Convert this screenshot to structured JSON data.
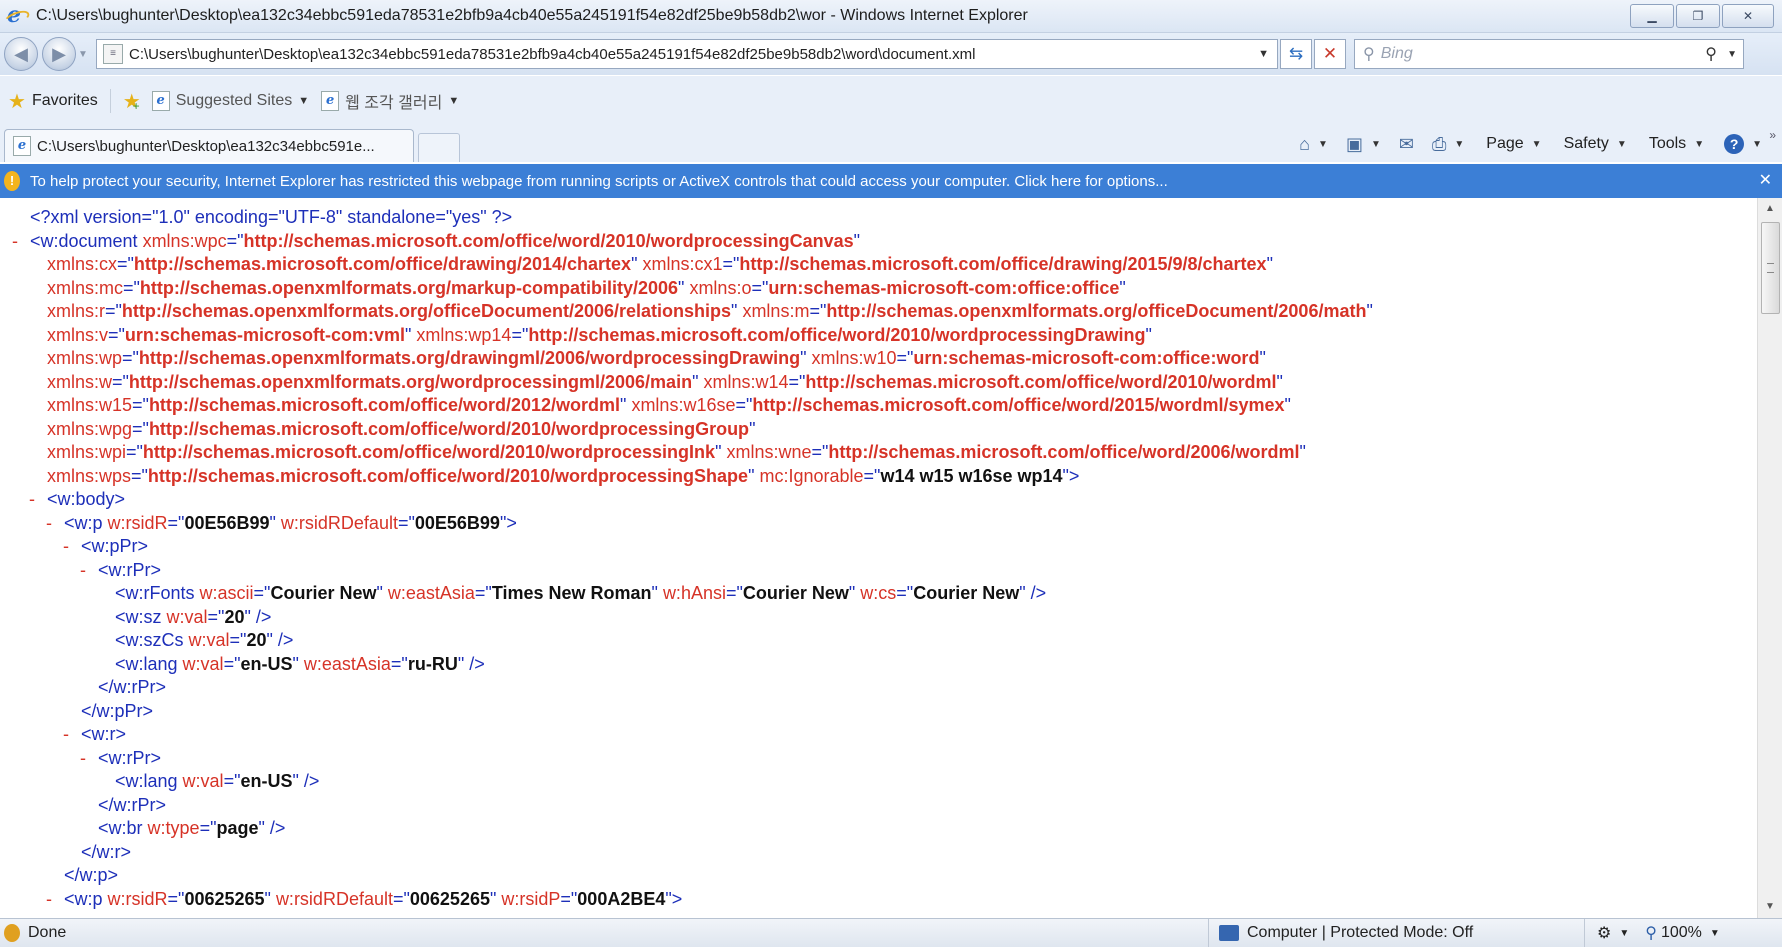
{
  "window": {
    "title": "C:\\Users\\bughunter\\Desktop\\ea132c34ebbc591eda78531e2bfb9a4cb40e55a245191f54e82df25be9b58db2\\wor - Windows Internet Explorer"
  },
  "address_bar": {
    "url": "C:\\Users\\bughunter\\Desktop\\ea132c34ebbc591eda78531e2bfb9a4cb40e55a245191f54e82df25be9b58db2\\word\\document.xml"
  },
  "search": {
    "placeholder": "Bing"
  },
  "favorites_bar": {
    "favorites_label": "Favorites",
    "links": [
      "Suggested Sites",
      "웹 조각 갤러리"
    ]
  },
  "tab": {
    "title": "C:\\Users\\bughunter\\Desktop\\ea132c34ebbc591e..."
  },
  "command_bar": {
    "page": "Page",
    "safety": "Safety",
    "tools": "Tools"
  },
  "info_bar": {
    "message": "To help protect your security, Internet Explorer has restricted this webpage from running scripts or ActiveX controls that could access your computer. Click here for options..."
  },
  "xml_lines": [
    {
      "indent": 0,
      "toggle": "",
      "parts": [
        [
          "tg",
          "<?xml "
        ],
        [
          "tg",
          "version=\""
        ],
        [
          "tg",
          "1.0"
        ],
        [
          "tg",
          "\" encoding=\""
        ],
        [
          "tg",
          "UTF-8"
        ],
        [
          "tg",
          "\" standalone=\""
        ],
        [
          "tg",
          "yes"
        ],
        [
          "tg",
          "\" ?>"
        ]
      ]
    },
    {
      "indent": 0,
      "toggle": "-",
      "parts": [
        [
          "tg",
          "<w:document "
        ],
        [
          "an",
          "xmlns:wpc"
        ],
        [
          "tg",
          "=\""
        ],
        [
          "uv",
          "http://schemas.microsoft.com/office/word/2010/wordprocessingCanvas"
        ],
        [
          "tg",
          "\""
        ]
      ]
    },
    {
      "indent": 1,
      "toggle": "",
      "parts": [
        [
          "an",
          "xmlns:cx"
        ],
        [
          "tg",
          "=\""
        ],
        [
          "uv",
          "http://schemas.microsoft.com/office/drawing/2014/chartex"
        ],
        [
          "tg",
          "\" "
        ],
        [
          "an",
          "xmlns:cx1"
        ],
        [
          "tg",
          "=\""
        ],
        [
          "uv",
          "http://schemas.microsoft.com/office/drawing/2015/9/8/chartex"
        ],
        [
          "tg",
          "\""
        ]
      ]
    },
    {
      "indent": 1,
      "toggle": "",
      "parts": [
        [
          "an",
          "xmlns:mc"
        ],
        [
          "tg",
          "=\""
        ],
        [
          "uv",
          "http://schemas.openxmlformats.org/markup-compatibility/2006"
        ],
        [
          "tg",
          "\" "
        ],
        [
          "an",
          "xmlns:o"
        ],
        [
          "tg",
          "=\""
        ],
        [
          "uv",
          "urn:schemas-microsoft-com:office:office"
        ],
        [
          "tg",
          "\""
        ]
      ]
    },
    {
      "indent": 1,
      "toggle": "",
      "parts": [
        [
          "an",
          "xmlns:r"
        ],
        [
          "tg",
          "=\""
        ],
        [
          "uv",
          "http://schemas.openxmlformats.org/officeDocument/2006/relationships"
        ],
        [
          "tg",
          "\" "
        ],
        [
          "an",
          "xmlns:m"
        ],
        [
          "tg",
          "=\""
        ],
        [
          "uv",
          "http://schemas.openxmlformats.org/officeDocument/2006/math"
        ],
        [
          "tg",
          "\""
        ]
      ]
    },
    {
      "indent": 1,
      "toggle": "",
      "parts": [
        [
          "an",
          "xmlns:v"
        ],
        [
          "tg",
          "=\""
        ],
        [
          "uv",
          "urn:schemas-microsoft-com:vml"
        ],
        [
          "tg",
          "\" "
        ],
        [
          "an",
          "xmlns:wp14"
        ],
        [
          "tg",
          "=\""
        ],
        [
          "uv",
          "http://schemas.microsoft.com/office/word/2010/wordprocessingDrawing"
        ],
        [
          "tg",
          "\""
        ]
      ]
    },
    {
      "indent": 1,
      "toggle": "",
      "parts": [
        [
          "an",
          "xmlns:wp"
        ],
        [
          "tg",
          "=\""
        ],
        [
          "uv",
          "http://schemas.openxmlformats.org/drawingml/2006/wordprocessingDrawing"
        ],
        [
          "tg",
          "\" "
        ],
        [
          "an",
          "xmlns:w10"
        ],
        [
          "tg",
          "=\""
        ],
        [
          "uv",
          "urn:schemas-microsoft-com:office:word"
        ],
        [
          "tg",
          "\""
        ]
      ]
    },
    {
      "indent": 1,
      "toggle": "",
      "parts": [
        [
          "an",
          "xmlns:w"
        ],
        [
          "tg",
          "=\""
        ],
        [
          "uv",
          "http://schemas.openxmlformats.org/wordprocessingml/2006/main"
        ],
        [
          "tg",
          "\" "
        ],
        [
          "an",
          "xmlns:w14"
        ],
        [
          "tg",
          "=\""
        ],
        [
          "uv",
          "http://schemas.microsoft.com/office/word/2010/wordml"
        ],
        [
          "tg",
          "\""
        ]
      ]
    },
    {
      "indent": 1,
      "toggle": "",
      "parts": [
        [
          "an",
          "xmlns:w15"
        ],
        [
          "tg",
          "=\""
        ],
        [
          "uv",
          "http://schemas.microsoft.com/office/word/2012/wordml"
        ],
        [
          "tg",
          "\" "
        ],
        [
          "an",
          "xmlns:w16se"
        ],
        [
          "tg",
          "=\""
        ],
        [
          "uv",
          "http://schemas.microsoft.com/office/word/2015/wordml/symex"
        ],
        [
          "tg",
          "\""
        ]
      ]
    },
    {
      "indent": 1,
      "toggle": "",
      "parts": [
        [
          "an",
          "xmlns:wpg"
        ],
        [
          "tg",
          "=\""
        ],
        [
          "uv",
          "http://schemas.microsoft.com/office/word/2010/wordprocessingGroup"
        ],
        [
          "tg",
          "\""
        ]
      ]
    },
    {
      "indent": 1,
      "toggle": "",
      "parts": [
        [
          "an",
          "xmlns:wpi"
        ],
        [
          "tg",
          "=\""
        ],
        [
          "uv",
          "http://schemas.microsoft.com/office/word/2010/wordprocessingInk"
        ],
        [
          "tg",
          "\" "
        ],
        [
          "an",
          "xmlns:wne"
        ],
        [
          "tg",
          "=\""
        ],
        [
          "uv",
          "http://schemas.microsoft.com/office/word/2006/wordml"
        ],
        [
          "tg",
          "\""
        ]
      ]
    },
    {
      "indent": 1,
      "toggle": "",
      "parts": [
        [
          "an",
          "xmlns:wps"
        ],
        [
          "tg",
          "=\""
        ],
        [
          "uv",
          "http://schemas.microsoft.com/office/word/2010/wordprocessingShape"
        ],
        [
          "tg",
          "\" "
        ],
        [
          "an",
          "mc:Ignorable"
        ],
        [
          "tg",
          "=\""
        ],
        [
          "av",
          "w14 w15 w16se wp14"
        ],
        [
          "tg",
          "\">"
        ]
      ]
    },
    {
      "indent": 1,
      "toggle": "-",
      "parts": [
        [
          "tg",
          "<w:body>"
        ]
      ]
    },
    {
      "indent": 2,
      "toggle": "-",
      "parts": [
        [
          "tg",
          "<w:p "
        ],
        [
          "an",
          "w:rsidR"
        ],
        [
          "tg",
          "=\""
        ],
        [
          "av",
          "00E56B99"
        ],
        [
          "tg",
          "\" "
        ],
        [
          "an",
          "w:rsidRDefault"
        ],
        [
          "tg",
          "=\""
        ],
        [
          "av",
          "00E56B99"
        ],
        [
          "tg",
          "\">"
        ]
      ]
    },
    {
      "indent": 3,
      "toggle": "-",
      "parts": [
        [
          "tg",
          "<w:pPr>"
        ]
      ]
    },
    {
      "indent": 4,
      "toggle": "-",
      "parts": [
        [
          "tg",
          "<w:rPr>"
        ]
      ]
    },
    {
      "indent": 5,
      "toggle": "",
      "parts": [
        [
          "tg",
          "<w:rFonts "
        ],
        [
          "an",
          "w:ascii"
        ],
        [
          "tg",
          "=\""
        ],
        [
          "av",
          "Courier New"
        ],
        [
          "tg",
          "\" "
        ],
        [
          "an",
          "w:eastAsia"
        ],
        [
          "tg",
          "=\""
        ],
        [
          "av",
          "Times New Roman"
        ],
        [
          "tg",
          "\" "
        ],
        [
          "an",
          "w:hAnsi"
        ],
        [
          "tg",
          "=\""
        ],
        [
          "av",
          "Courier New"
        ],
        [
          "tg",
          "\" "
        ],
        [
          "an",
          "w:cs"
        ],
        [
          "tg",
          "=\""
        ],
        [
          "av",
          "Courier New"
        ],
        [
          "tg",
          "\" />"
        ]
      ]
    },
    {
      "indent": 5,
      "toggle": "",
      "parts": [
        [
          "tg",
          "<w:sz "
        ],
        [
          "an",
          "w:val"
        ],
        [
          "tg",
          "=\""
        ],
        [
          "av",
          "20"
        ],
        [
          "tg",
          "\" />"
        ]
      ]
    },
    {
      "indent": 5,
      "toggle": "",
      "parts": [
        [
          "tg",
          "<w:szCs "
        ],
        [
          "an",
          "w:val"
        ],
        [
          "tg",
          "=\""
        ],
        [
          "av",
          "20"
        ],
        [
          "tg",
          "\" />"
        ]
      ]
    },
    {
      "indent": 5,
      "toggle": "",
      "parts": [
        [
          "tg",
          "<w:lang "
        ],
        [
          "an",
          "w:val"
        ],
        [
          "tg",
          "=\""
        ],
        [
          "av",
          "en-US"
        ],
        [
          "tg",
          "\" "
        ],
        [
          "an",
          "w:eastAsia"
        ],
        [
          "tg",
          "=\""
        ],
        [
          "av",
          "ru-RU"
        ],
        [
          "tg",
          "\" />"
        ]
      ]
    },
    {
      "indent": 4,
      "toggle": "",
      "parts": [
        [
          "tg",
          "</w:rPr>"
        ]
      ]
    },
    {
      "indent": 3,
      "toggle": "",
      "parts": [
        [
          "tg",
          "</w:pPr>"
        ]
      ]
    },
    {
      "indent": 3,
      "toggle": "-",
      "parts": [
        [
          "tg",
          "<w:r>"
        ]
      ]
    },
    {
      "indent": 4,
      "toggle": "-",
      "parts": [
        [
          "tg",
          "<w:rPr>"
        ]
      ]
    },
    {
      "indent": 5,
      "toggle": "",
      "parts": [
        [
          "tg",
          "<w:lang "
        ],
        [
          "an",
          "w:val"
        ],
        [
          "tg",
          "=\""
        ],
        [
          "av",
          "en-US"
        ],
        [
          "tg",
          "\" />"
        ]
      ]
    },
    {
      "indent": 4,
      "toggle": "",
      "parts": [
        [
          "tg",
          "</w:rPr>"
        ]
      ]
    },
    {
      "indent": 4,
      "toggle": "",
      "parts": [
        [
          "tg",
          "<w:br "
        ],
        [
          "an",
          "w:type"
        ],
        [
          "tg",
          "=\""
        ],
        [
          "av",
          "page"
        ],
        [
          "tg",
          "\" />"
        ]
      ]
    },
    {
      "indent": 3,
      "toggle": "",
      "parts": [
        [
          "tg",
          "</w:r>"
        ]
      ]
    },
    {
      "indent": 2,
      "toggle": "",
      "parts": [
        [
          "tg",
          "</w:p>"
        ]
      ]
    },
    {
      "indent": 2,
      "toggle": "-",
      "parts": [
        [
          "tg",
          "<w:p "
        ],
        [
          "an",
          "w:rsidR"
        ],
        [
          "tg",
          "=\""
        ],
        [
          "av",
          "00625265"
        ],
        [
          "tg",
          "\" "
        ],
        [
          "an",
          "w:rsidRDefault"
        ],
        [
          "tg",
          "=\""
        ],
        [
          "av",
          "00625265"
        ],
        [
          "tg",
          "\" "
        ],
        [
          "an",
          "w:rsidP"
        ],
        [
          "tg",
          "=\""
        ],
        [
          "av",
          "000A2BE4"
        ],
        [
          "tg",
          "\">"
        ]
      ]
    }
  ],
  "status_bar": {
    "status": "Done",
    "zone": "Computer | Protected Mode: Off",
    "zoom": "100%"
  },
  "colors": {
    "info_bar": "#3c7fd6",
    "xml_tag": "#1d2fb9",
    "xml_attr": "#d63327",
    "xml_value": "#111111"
  }
}
